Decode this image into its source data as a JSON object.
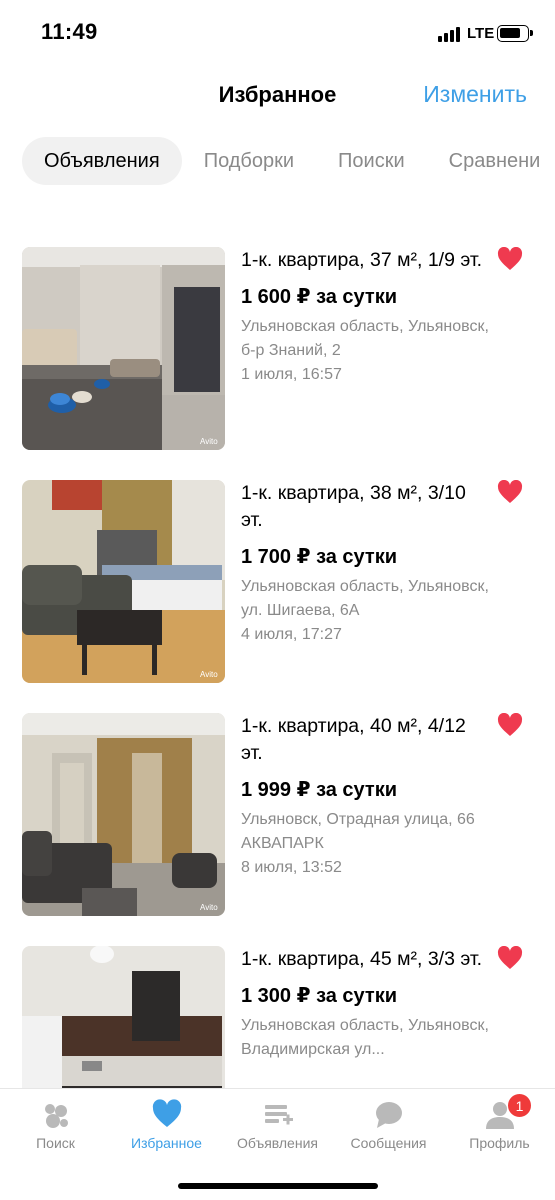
{
  "status_bar": {
    "time": "11:49",
    "network": "LTE"
  },
  "header": {
    "title": "Избранное",
    "edit_label": "Изменить"
  },
  "tabs": [
    {
      "label": "Объявления",
      "active": true
    },
    {
      "label": "Подборки",
      "active": false
    },
    {
      "label": "Поиски",
      "active": false
    },
    {
      "label": "Сравнени",
      "active": false
    }
  ],
  "listings": [
    {
      "title": "1-к. квартира, 37 м², 1/9 эт.",
      "price": "1 600 ₽ за сутки",
      "address": "Ульяновская область, Ульяновск, б-р Знаний, 2",
      "date": "1 июля, 16:57",
      "favorite": true
    },
    {
      "title": "1-к. квартира, 38 м², 3/10 эт.",
      "price": "1 700 ₽ за сутки",
      "address": "Ульяновская область, Ульяновск, ул. Шигаева, 6А",
      "date": "4 июля, 17:27",
      "favorite": true
    },
    {
      "title": "1-к. квартира, 40 м², 4/12 эт.",
      "price": "1 999 ₽ за сутки",
      "address": "Ульяновск, Отрадная улица, 66 АКВАПАРК",
      "date": "8 июля, 13:52",
      "favorite": true
    },
    {
      "title": "1-к. квартира, 45 м², 3/3 эт.",
      "price": "1 300 ₽ за сутки",
      "address": "Ульяновская область, Ульяновск, Владимирская ул...",
      "date": "",
      "favorite": true
    }
  ],
  "watermark": "Avito",
  "bottom_nav": [
    {
      "label": "Поиск",
      "icon": "search-bubbles-icon",
      "active": false
    },
    {
      "label": "Избранное",
      "icon": "heart-icon",
      "active": true
    },
    {
      "label": "Объявления",
      "icon": "add-listing-icon",
      "active": false
    },
    {
      "label": "Сообщения",
      "icon": "chat-bubble-icon",
      "active": false
    },
    {
      "label": "Профиль",
      "icon": "profile-icon",
      "active": false,
      "badge": "1"
    }
  ],
  "colors": {
    "accent": "#3e9fe6",
    "heart": "#ef3a4f",
    "muted": "#8a8a8a",
    "badge": "#ef3a3a"
  }
}
